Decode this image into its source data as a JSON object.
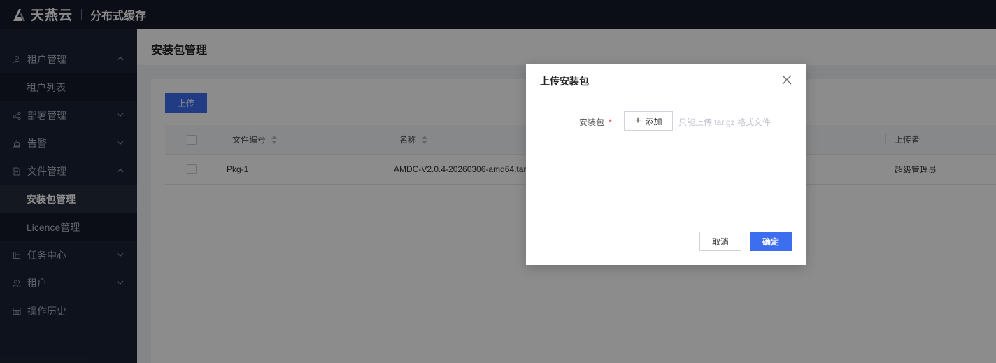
{
  "topbar": {
    "brand": "天燕云",
    "product": "分布式缓存"
  },
  "sidebar": {
    "items": [
      {
        "label": "租户管理",
        "icon": "user-icon",
        "expanded": true
      },
      {
        "label": "租户列表",
        "sub": true
      },
      {
        "label": "部署管理",
        "icon": "share-icon",
        "expanded": false
      },
      {
        "label": "告警",
        "icon": "alarm-icon",
        "expanded": false
      },
      {
        "label": "文件管理",
        "icon": "file-icon",
        "expanded": true
      },
      {
        "label": "安装包管理",
        "sub": true,
        "active": true
      },
      {
        "label": "Licence管理",
        "sub": true
      },
      {
        "label": "任务中心",
        "icon": "task-icon",
        "expanded": false
      },
      {
        "label": "租户",
        "icon": "users-icon",
        "expanded": false
      },
      {
        "label": "操作历史",
        "icon": "history-icon"
      }
    ]
  },
  "page": {
    "title": "安装包管理",
    "upload_label": "上传"
  },
  "table": {
    "headers": {
      "file_no": "文件编号",
      "name": "名称",
      "uploader": "上传者"
    },
    "rows": [
      {
        "file_no": "Pkg-1",
        "name": "AMDC-V2.0.4-20260306-amd64.tar.",
        "uploader": "超级管理员"
      }
    ]
  },
  "modal": {
    "title": "上传安装包",
    "field_label": "安装包",
    "required_mark": "*",
    "add_label": "添加",
    "hint": "只能上传 tar.gz 格式文件",
    "cancel_label": "取消",
    "ok_label": "确定"
  },
  "colors": {
    "primary": "#3d6ef0",
    "topbar_bg": "#141a29",
    "sidebar_bg": "#1b2233",
    "required": "#e5484d"
  }
}
